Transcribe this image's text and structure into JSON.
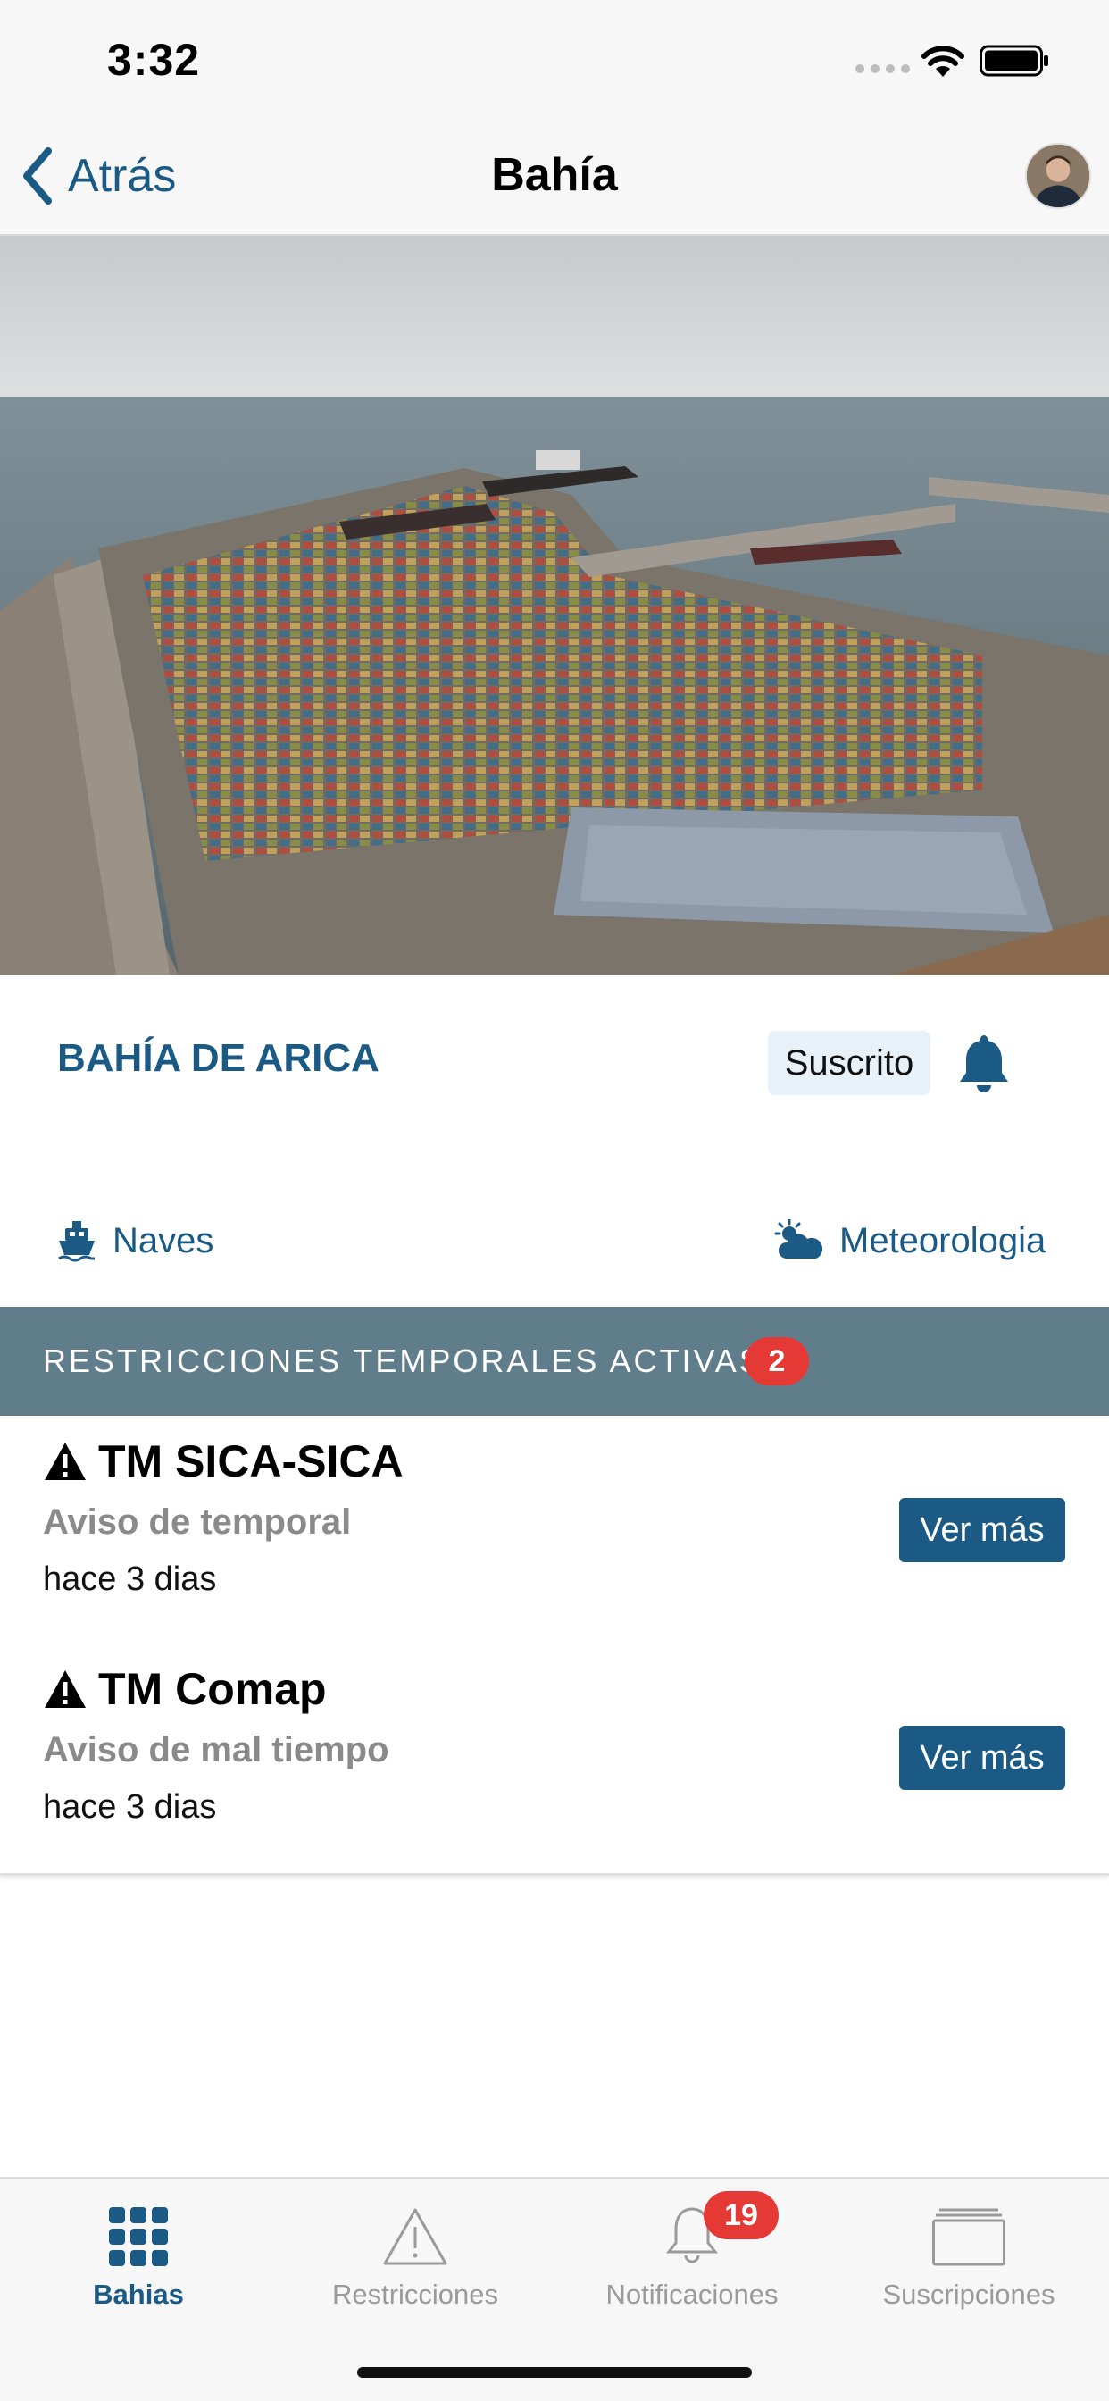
{
  "status_bar": {
    "time": "3:32"
  },
  "nav": {
    "back_label": "Atrás",
    "title": "Bahía"
  },
  "bay": {
    "name": "BAHÍA DE ARICA",
    "subscribed_label": "Suscrito",
    "links": {
      "ships": "Naves",
      "weather": "Meteorologia"
    }
  },
  "restrictions": {
    "section_title": "RESTRICCIONES TEMPORALES ACTIVAS",
    "count": "2",
    "items": [
      {
        "title": "TM SICA-SICA",
        "subtitle": "Aviso de temporal",
        "time": "hace 3 dias",
        "button": "Ver más"
      },
      {
        "title": "TM Comap",
        "subtitle": "Aviso de mal tiempo",
        "time": "hace 3 dias",
        "button": "Ver más"
      }
    ]
  },
  "tabs": {
    "bahias": "Bahias",
    "restricciones": "Restricciones",
    "notificaciones": "Notificaciones",
    "notificaciones_badge": "19",
    "suscripciones": "Suscripciones"
  },
  "colors": {
    "accent": "#1a5a85",
    "section": "#607d8b",
    "badge": "#e53935"
  }
}
